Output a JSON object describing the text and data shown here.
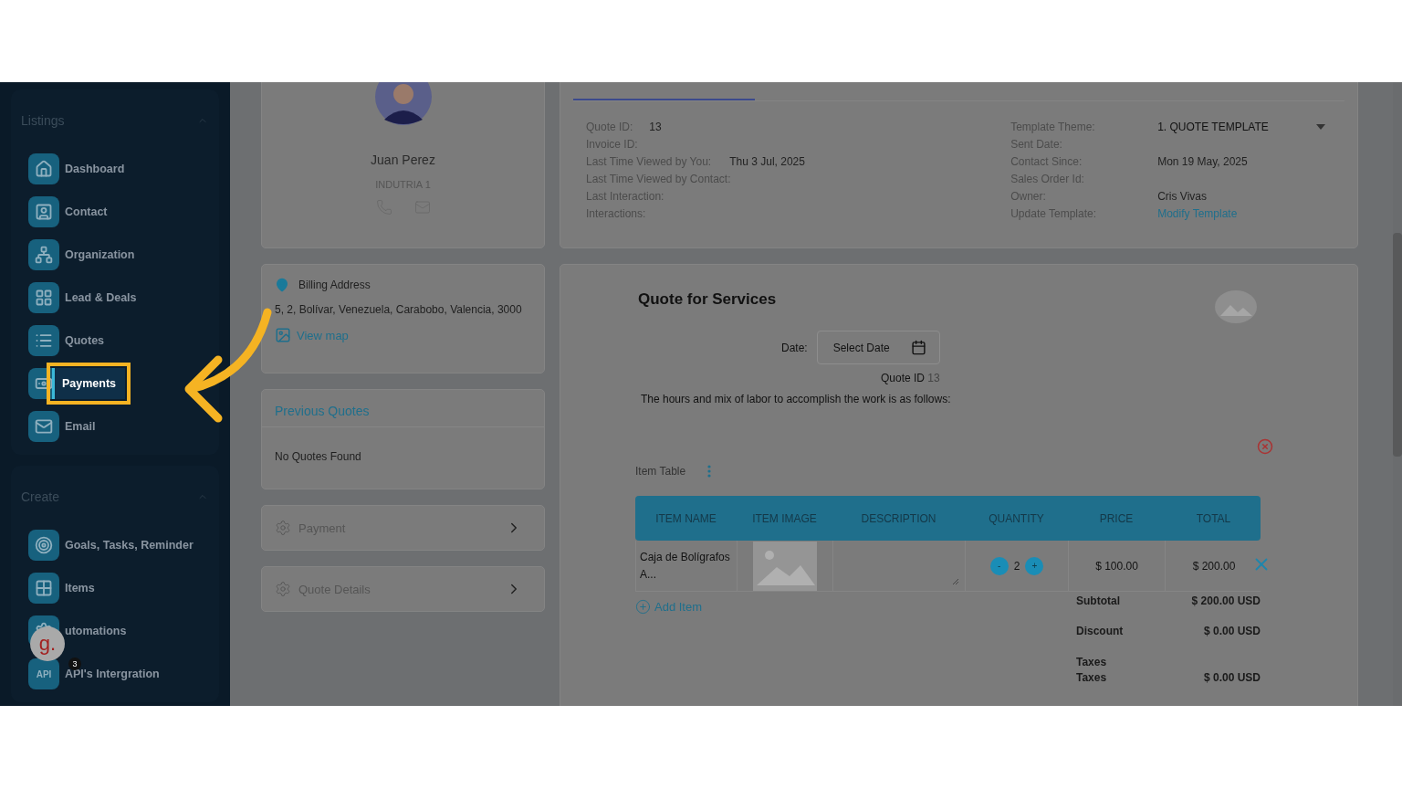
{
  "sidebar": {
    "sections": [
      {
        "title": "Listings",
        "expanded": true,
        "items": [
          {
            "label": "Dashboard",
            "selected": false
          },
          {
            "label": "Contact",
            "selected": false
          },
          {
            "label": "Organization",
            "selected": false
          },
          {
            "label": "Lead & Deals",
            "selected": false
          },
          {
            "label": "Quotes",
            "selected": false
          },
          {
            "label": "Payments",
            "selected": true
          },
          {
            "label": "Email",
            "selected": false
          }
        ]
      },
      {
        "title": "Create",
        "expanded": true,
        "items": [
          {
            "label": "Goals, Tasks, Reminder",
            "selected": false
          },
          {
            "label": "Items",
            "selected": false
          },
          {
            "label": "utomations",
            "selected": false
          },
          {
            "label": "API's Intergration",
            "selected": false,
            "icon_text": "API"
          }
        ]
      }
    ]
  },
  "chat_badge": {
    "letter": "g.",
    "count": "3"
  },
  "contact": {
    "name": "Juan Perez",
    "company": "INDUTRIA 1"
  },
  "billing": {
    "title": "Billing Address",
    "address": "5, 2, Bolívar, Venezuela, Carabobo, Valencia, 3000",
    "link": "View map"
  },
  "previous_quotes": {
    "title": "Previous Quotes",
    "empty": "No Quotes Found"
  },
  "panels": [
    {
      "label": "Payment"
    },
    {
      "label": "Quote Details"
    }
  ],
  "quote_info": {
    "left": [
      {
        "label": "Quote ID:",
        "value": "13"
      },
      {
        "label": "Invoice ID:"
      },
      {
        "label": "Last Time Viewed by You:",
        "value": "Thu 3 Jul, 2025"
      },
      {
        "label": "Last Time Viewed by Contact:"
      },
      {
        "label": "Last Interaction:"
      },
      {
        "label": "Interactions:"
      }
    ],
    "right": [
      {
        "label": "Template Theme:",
        "value": "1. QUOTE TEMPLATE",
        "kind": "select"
      },
      {
        "label": "Sent Date:"
      },
      {
        "label": "Contact Since:",
        "value": "Mon 19 May, 2025",
        "kind": "text"
      },
      {
        "label": "Sales Order Id:"
      },
      {
        "label": "Owner:",
        "value": "Cris Vivas",
        "kind": "text"
      },
      {
        "label": "Update Template:",
        "value": "Modify Template",
        "kind": "link"
      }
    ]
  },
  "quote": {
    "title": "Quote for Services",
    "date_label": "Date:",
    "date_placeholder": "Select Date",
    "quote_id_label": "Quote ID",
    "quote_id": "13",
    "intro": "The hours and mix of labor to accomplish the work is as follows:",
    "item_table_label": "Item Table",
    "columns": [
      "ITEM NAME",
      "ITEM IMAGE",
      "DESCRIPTION",
      "QUANTITY",
      "PRICE",
      "TOTAL"
    ],
    "rows": [
      {
        "name": "Caja de Bolígrafos A...",
        "quantity": "2",
        "price": "$ 100.00",
        "total": "$ 200.00"
      }
    ],
    "add_item": "Add Item",
    "decrease": "-",
    "increase": "+",
    "totals": [
      {
        "label": "Subtotal",
        "value": "$ 200.00 USD",
        "kind": "line"
      },
      {
        "label": "Discount",
        "value": "$ 0.00 USD",
        "kind": "line"
      },
      {
        "label": "Taxes",
        "kind": "heading"
      },
      {
        "label": "Taxes",
        "value": "$ 0.00 USD",
        "kind": "line"
      }
    ]
  }
}
